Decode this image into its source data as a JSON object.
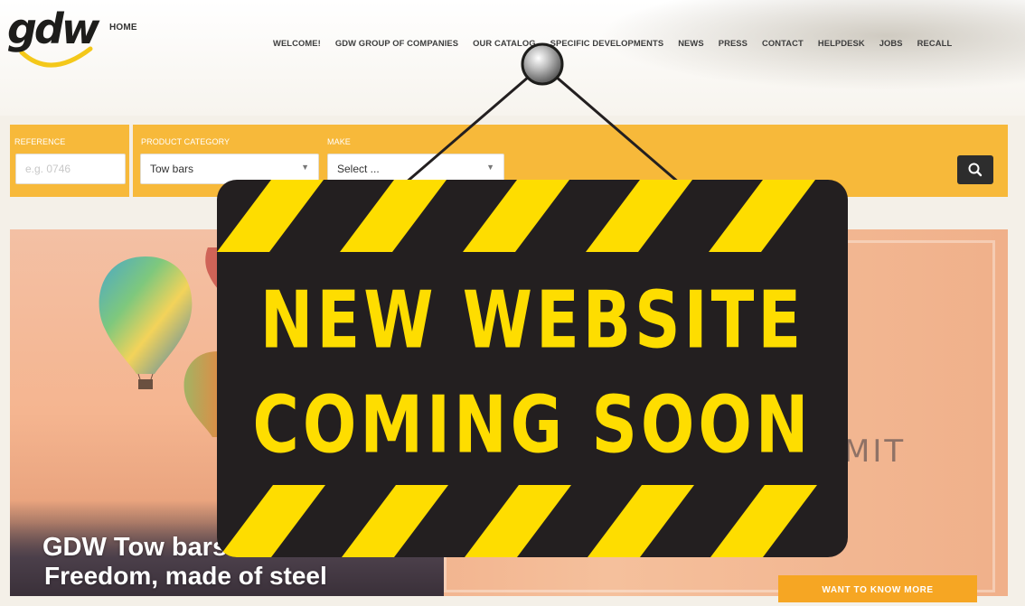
{
  "header": {
    "home_link": "HOME",
    "nav": [
      {
        "label": "WELCOME!"
      },
      {
        "label": "GDW GROUP OF COMPANIES"
      },
      {
        "label": "OUR CATALOG"
      },
      {
        "label": "SPECIFIC DEVELOPMENTS"
      },
      {
        "label": "NEWS"
      },
      {
        "label": "PRESS"
      },
      {
        "label": "CONTACT"
      },
      {
        "label": "HELPDESK"
      },
      {
        "label": "JOBS"
      },
      {
        "label": "RECALL"
      }
    ]
  },
  "search": {
    "reference_label": "REFERENCE",
    "reference_placeholder": "e.g. 0746",
    "category_label": "PRODUCT CATEGORY",
    "category_value": "Tow bars",
    "make_label": "MAKE",
    "make_value": "Select ...",
    "search_icon": "search-icon"
  },
  "hero": {
    "title": "GDW Tow bars",
    "subtitle": "Freedom, made of steel",
    "background_text": "MIT",
    "cta_label": "WANT TO KNOW MORE"
  },
  "sign": {
    "line1": "NEW WEBSITE",
    "line2": "COMING SOON"
  },
  "colors": {
    "accent": "#f7b93a",
    "sign_background": "#231f20",
    "sign_yellow": "#fedd00",
    "cta": "#f6a623"
  }
}
